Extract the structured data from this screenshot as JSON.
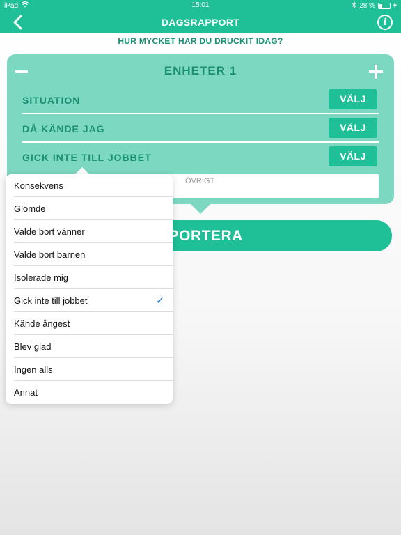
{
  "statusbar": {
    "device": "iPad",
    "time": "15:01",
    "battery": "28 %",
    "battery_level": 0.28
  },
  "navbar": {
    "title": "DAGSRAPPORT"
  },
  "question": "HUR MYCKET HAR DU DRUCKIT IDAG?",
  "card": {
    "units_label": "ENHETER 1",
    "rows": [
      {
        "label": "SITUATION",
        "button": "VÄLJ"
      },
      {
        "label": "DÅ KÄNDE JAG",
        "button": "VÄLJ"
      },
      {
        "label": "GICK INTE TILL JOBBET",
        "button": "VÄLJ"
      }
    ],
    "other_placeholder": "ÖVRIGT"
  },
  "report_button": "PPORTERA",
  "options": [
    {
      "label": "Konsekvens",
      "selected": false
    },
    {
      "label": "Glömde",
      "selected": false
    },
    {
      "label": "Valde bort vänner",
      "selected": false
    },
    {
      "label": "Valde bort barnen",
      "selected": false
    },
    {
      "label": "Isolerade mig",
      "selected": false
    },
    {
      "label": "Gick inte till jobbet",
      "selected": true
    },
    {
      "label": "Kände ångest",
      "selected": false
    },
    {
      "label": "Blev glad",
      "selected": false
    },
    {
      "label": "Ingen alls",
      "selected": false
    },
    {
      "label": "Annat",
      "selected": false
    }
  ],
  "colors": {
    "brand": "#1fbf98",
    "card": "#7dd8c1",
    "text_accent": "#1a8f74",
    "check": "#1e7ce8"
  },
  "icons": {
    "back": "chevron-left-icon",
    "info": "info-icon",
    "minus": "minus-icon",
    "plus": "plus-icon",
    "check": "checkmark-icon",
    "wifi": "wifi-icon",
    "bluetooth": "bluetooth-icon",
    "battery": "battery-icon",
    "charging": "bolt-icon"
  }
}
